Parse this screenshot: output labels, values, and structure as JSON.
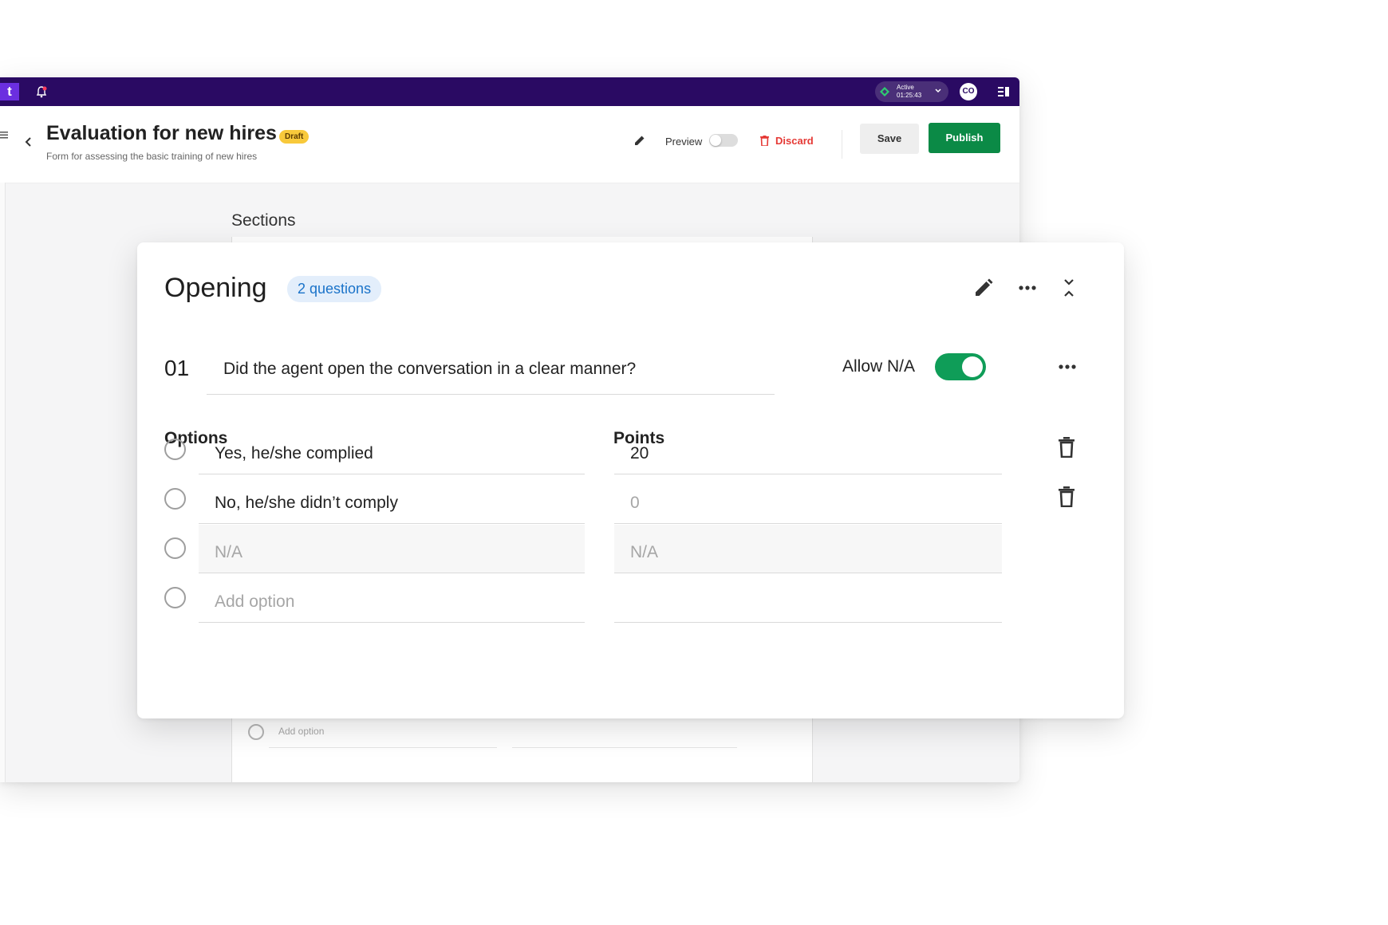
{
  "topbar": {
    "logo": "t",
    "status": {
      "label": "Active",
      "timer": "01:25:43"
    },
    "avatar_initials": "CO"
  },
  "header": {
    "title": "Evaluation for new hires",
    "badge": "Draft",
    "subtitle": "Form for assessing the basic training of new hires",
    "preview_label": "Preview",
    "discard_label": "Discard",
    "save_label": "Save",
    "publish_label": "Publish"
  },
  "background": {
    "sections_label": "Sections",
    "add_option": "Add option"
  },
  "section": {
    "title": "Opening",
    "count_badge": "2 questions",
    "question": {
      "number": "01",
      "text": "Did the agent open the conversation in a clear manner?",
      "allow_na_label": "Allow N/A",
      "allow_na": true
    },
    "options_header": "Options",
    "points_header": "Points",
    "options": [
      {
        "label": "Yes, he/she complied",
        "points": "20"
      },
      {
        "label": "No, he/she didn’t comply",
        "points_placeholder": "0"
      },
      {
        "label_placeholder": "N/A",
        "points_placeholder": "N/A"
      },
      {
        "label_placeholder": "Add option"
      }
    ]
  },
  "colors": {
    "topbar": "#2a0a63",
    "publish": "#0b8a46",
    "toggle_on": "#0f9d58",
    "discard": "#e53935",
    "draft_badge": "#f8c93b",
    "questions_badge": "#e3eefb"
  }
}
